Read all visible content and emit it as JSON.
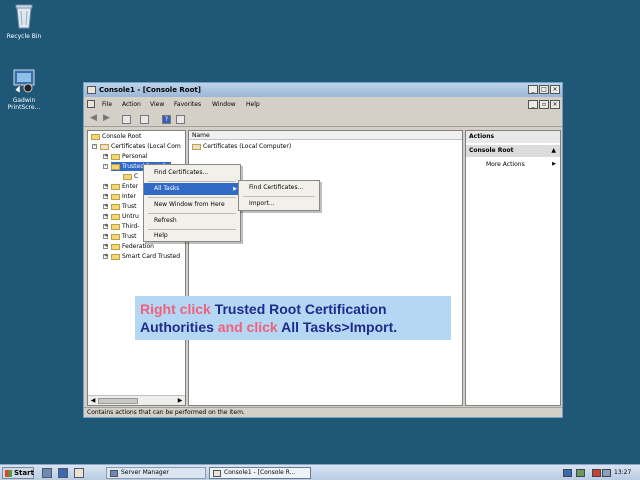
{
  "desktop": {
    "icons": [
      {
        "label": "Recycle Bin"
      },
      {
        "label_line1": "Gadwin",
        "label_line2": "PrintScre..."
      }
    ]
  },
  "window": {
    "title": "Console1 - [Console Root]",
    "caption_buttons": {
      "minimize": "_",
      "maximize": "□",
      "close": "×"
    },
    "inner_buttons": {
      "minimize": "_",
      "restore": "▫",
      "close": "×"
    },
    "menu": [
      "File",
      "Action",
      "View",
      "Favorites",
      "Window",
      "Help"
    ],
    "toolbar_icons": [
      "back-icon",
      "forward-icon",
      "up-icon",
      "properties-icon",
      "help-icon",
      "show-hide-icon"
    ],
    "tree": {
      "items": [
        {
          "label": "Console Root"
        },
        {
          "label": "Certificates (Local Com"
        },
        {
          "label": "Personal"
        },
        {
          "label": "Trusted Root Ce"
        },
        {
          "label": "C"
        },
        {
          "label": "Enter"
        },
        {
          "label": "Inter"
        },
        {
          "label": "Trust"
        },
        {
          "label": "Untru"
        },
        {
          "label": "Third-"
        },
        {
          "label": "Trust"
        },
        {
          "label": "Federation"
        },
        {
          "label": "Smart Card Trusted"
        }
      ]
    },
    "list": {
      "column_header": "Name",
      "rows": [
        {
          "label": "Certificates (Local Computer)"
        }
      ]
    },
    "actions": {
      "title": "Actions",
      "section": "Console Root",
      "items": [
        {
          "label": "More Actions"
        }
      ]
    },
    "status_text": "Contains actions that can be performed on the item."
  },
  "context_menu": {
    "items": [
      {
        "label": "Find Certificates..."
      },
      {
        "label": "All Tasks"
      },
      {
        "label": "New Window from Here"
      },
      {
        "label": "Refresh"
      },
      {
        "label": "Help"
      }
    ],
    "submenu": [
      {
        "label": "Find Certificates..."
      },
      {
        "label": "Import..."
      }
    ]
  },
  "callout": {
    "p1": "Right click ",
    "p2": "Trusted Root Certification Authorities",
    "p3": " and click ",
    "p4": "All Tasks>Import."
  },
  "taskbar": {
    "start_label": "Start",
    "tasks": [
      {
        "label": "Server Manager"
      },
      {
        "label": "Console1 - [Console R..."
      }
    ],
    "clock": "13:27"
  },
  "colors": {
    "desktop": "#1f5876",
    "callout_bg": "#b4d8f4",
    "callout_pink": "#f0607c",
    "callout_blue": "#1f2b8c",
    "selection": "#316ac5"
  }
}
